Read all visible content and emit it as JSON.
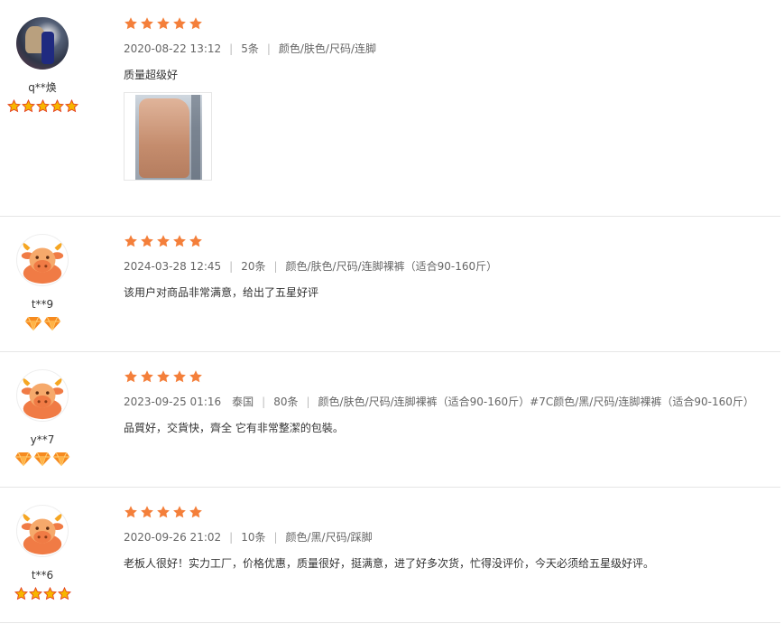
{
  "colors": {
    "star": "#f47f3a",
    "gold_star": "#f7b500",
    "diamond": "#f68a1f",
    "divider": "#e6e6e6",
    "meta_text": "#666666"
  },
  "reviews": [
    {
      "user": "q**焕",
      "avatar": "photo",
      "badge_type": "star-icon",
      "badge_count": 5,
      "rating": 5,
      "date": "2020-08-22 13:12",
      "location": "",
      "count": "5条",
      "spec": "颜色/肤色/尺码/连脚",
      "text": "质量超级好",
      "has_image": true
    },
    {
      "user": "t**9",
      "avatar": "cow",
      "badge_type": "diamond-icon",
      "badge_count": 2,
      "rating": 5,
      "date": "2024-03-28 12:45",
      "location": "",
      "count": "20条",
      "spec": "颜色/肤色/尺码/连脚裸裤（适合90-160斤）",
      "text": "该用户对商品非常满意，给出了五星好评",
      "has_image": false
    },
    {
      "user": "y**7",
      "avatar": "cow",
      "badge_type": "diamond-icon",
      "badge_count": 3,
      "rating": 5,
      "date": "2023-09-25 01:16",
      "location": "泰国",
      "count": "80条",
      "spec": "颜色/肤色/尺码/连脚裸裤（适合90-160斤）#7C颜色/黑/尺码/连脚裸裤（适合90-160斤）",
      "text": "品質好，交貨快，齊全 它有非常整潔的包裝。",
      "has_image": false
    },
    {
      "user": "t**6",
      "avatar": "cow",
      "badge_type": "star-icon",
      "badge_count": 4,
      "rating": 5,
      "date": "2020-09-26 21:02",
      "location": "",
      "count": "10条",
      "spec": "颜色/黑/尺码/踩脚",
      "text": "老板人很好！实力工厂，价格优惠，质量很好，挺满意，进了好多次货，忙得没评价，今天必须给五星级好评。",
      "has_image": true
    }
  ]
}
